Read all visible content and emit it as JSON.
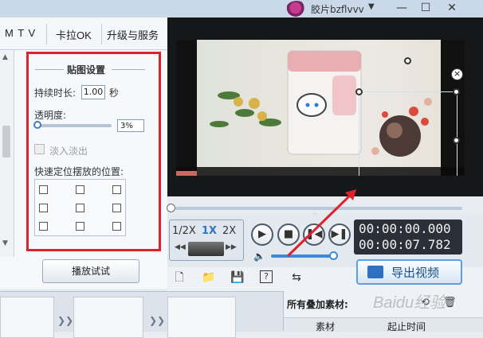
{
  "user": {
    "name": "胶片bzflvvv",
    "dropdown_glyph": "▼"
  },
  "window_controls": [
    "—",
    "☐",
    "✕"
  ],
  "menu": {
    "tabs": [
      "M T V",
      "卡拉OK",
      "升级与服务"
    ]
  },
  "sticker_settings": {
    "group_title": "贴图设置",
    "duration_label": "持续时长:",
    "duration_value": "1.00",
    "duration_unit": "秒",
    "transparency_label": "透明度:",
    "transparency_value": "3%",
    "transparency_level": 0.03,
    "fade_label": "淡入淡出",
    "fade_checked": false,
    "position_label": "快速定位摆放的位置:",
    "position_options": 9
  },
  "preview_button": "播放试试",
  "playback": {
    "speeds": [
      "1/2X",
      "1X",
      "2X"
    ],
    "active_speed": "1X",
    "time_current": "00:00:00.000",
    "time_total": "00:00:07.782",
    "progress": 0.0,
    "volume": 0.9
  },
  "export_button": "导出视频",
  "overlay_panel": {
    "title": "所有叠加素材:",
    "columns": [
      "素材",
      "起止时间"
    ]
  },
  "watermark": "Baidu经验",
  "colors": {
    "highlight_red": "#e0202a",
    "accent_blue": "#3d8bd6"
  }
}
